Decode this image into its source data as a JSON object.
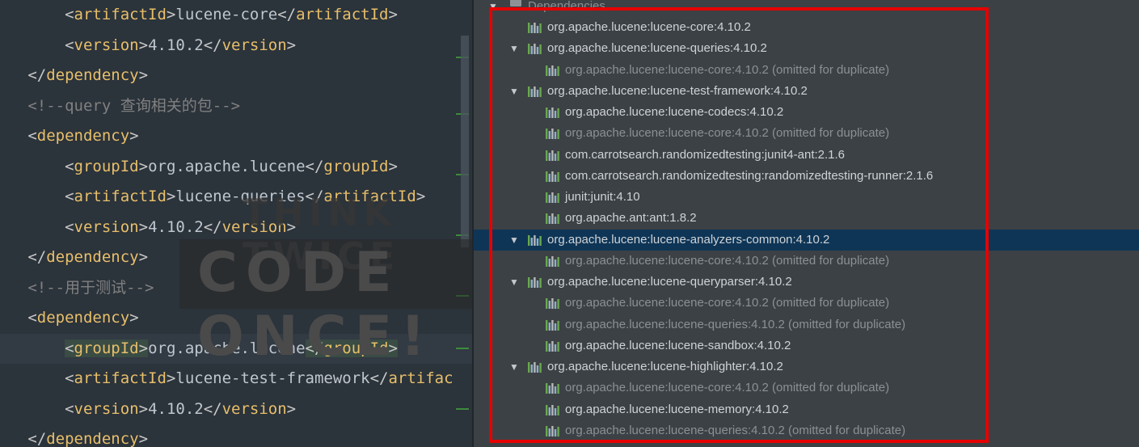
{
  "editor": {
    "lines": [
      {
        "indent": "    ",
        "tag": "artifactId",
        "value": "lucene-core",
        "close": "artifactId"
      },
      {
        "indent": "    ",
        "tag": "version",
        "value": "4.10.2",
        "close": "version"
      },
      {
        "indent": "",
        "closing_tag": "dependency"
      },
      {
        "indent": "",
        "comment": "<!--query 查询相关的包-->"
      },
      {
        "indent": "",
        "opening_tag": "dependency"
      },
      {
        "indent": "    ",
        "tag": "groupId",
        "value": "org.apache.lucene",
        "close": "groupId"
      },
      {
        "indent": "    ",
        "tag": "artifactId",
        "value": "lucene-queries",
        "close": "artifactId"
      },
      {
        "indent": "    ",
        "tag": "version",
        "value": "4.10.2",
        "close": "version"
      },
      {
        "indent": "",
        "closing_tag": "dependency"
      },
      {
        "indent": "",
        "comment": "<!--用于测试-->"
      },
      {
        "indent": "",
        "opening_tag": "dependency"
      },
      {
        "indent": "    ",
        "tag": "groupId",
        "value": "org.apache.lucene",
        "close": "groupId",
        "highlight": true
      },
      {
        "indent": "    ",
        "tag": "artifactId",
        "value": "lucene-test-framework",
        "close": "artifac"
      },
      {
        "indent": "    ",
        "tag": "version",
        "value": "4.10.2",
        "close": "version"
      },
      {
        "indent": "",
        "closing_tag": "dependency"
      }
    ],
    "watermark": {
      "line1": "THINK TWICE",
      "line2": "CODE ONCE!"
    }
  },
  "tree": {
    "root_label": "Dependencies",
    "rows": [
      {
        "level": 1,
        "expand": "",
        "text": "org.apache.lucene:lucene-core:4.10.2",
        "suffix": ""
      },
      {
        "level": 1,
        "expand": "▼",
        "text": "org.apache.lucene:lucene-queries:4.10.2",
        "suffix": ""
      },
      {
        "level": 2,
        "expand": "",
        "text": "org.apache.lucene:lucene-core:4.10.2",
        "suffix": "(omitted for duplicate)",
        "dim": true
      },
      {
        "level": 1,
        "expand": "▼",
        "text": "org.apache.lucene:lucene-test-framework:4.10.2",
        "suffix": ""
      },
      {
        "level": 2,
        "expand": "",
        "text": "org.apache.lucene:lucene-codecs:4.10.2",
        "suffix": ""
      },
      {
        "level": 2,
        "expand": "",
        "text": "org.apache.lucene:lucene-core:4.10.2",
        "suffix": "(omitted for duplicate)",
        "dim": true
      },
      {
        "level": 2,
        "expand": "",
        "text": "com.carrotsearch.randomizedtesting:junit4-ant:2.1.6",
        "suffix": ""
      },
      {
        "level": 2,
        "expand": "",
        "text": "com.carrotsearch.randomizedtesting:randomizedtesting-runner:2.1.6",
        "suffix": ""
      },
      {
        "level": 2,
        "expand": "",
        "text": "junit:junit:4.10",
        "suffix": ""
      },
      {
        "level": 2,
        "expand": "",
        "text": "org.apache.ant:ant:1.8.2",
        "suffix": ""
      },
      {
        "level": 1,
        "expand": "▼",
        "text": "org.apache.lucene:lucene-analyzers-common:4.10.2",
        "suffix": "",
        "selected": true
      },
      {
        "level": 2,
        "expand": "",
        "text": "org.apache.lucene:lucene-core:4.10.2",
        "suffix": "(omitted for duplicate)",
        "dim": true
      },
      {
        "level": 1,
        "expand": "▼",
        "text": "org.apache.lucene:lucene-queryparser:4.10.2",
        "suffix": ""
      },
      {
        "level": 2,
        "expand": "",
        "text": "org.apache.lucene:lucene-core:4.10.2",
        "suffix": "(omitted for duplicate)",
        "dim": true
      },
      {
        "level": 2,
        "expand": "",
        "text": "org.apache.lucene:lucene-queries:4.10.2",
        "suffix": "(omitted for duplicate)",
        "dim": true
      },
      {
        "level": 2,
        "expand": "",
        "text": "org.apache.lucene:lucene-sandbox:4.10.2",
        "suffix": ""
      },
      {
        "level": 1,
        "expand": "▼",
        "text": "org.apache.lucene:lucene-highlighter:4.10.2",
        "suffix": ""
      },
      {
        "level": 2,
        "expand": "",
        "text": "org.apache.lucene:lucene-core:4.10.2",
        "suffix": "(omitted for duplicate)",
        "dim": true
      },
      {
        "level": 2,
        "expand": "",
        "text": "org.apache.lucene:lucene-memory:4.10.2",
        "suffix": ""
      },
      {
        "level": 2,
        "expand": "",
        "text": "org.apache.lucene:lucene-queries:4.10.2",
        "suffix": "(omitted for duplicate)",
        "dim": true
      }
    ]
  },
  "colors": {
    "highlight_box": "#e60000",
    "selection": "#0e3556",
    "xml_tag": "#e8bf6a"
  },
  "icons": {
    "library": "library-bars-icon",
    "expand": "triangle-down-icon",
    "folder": "folder-icon"
  }
}
